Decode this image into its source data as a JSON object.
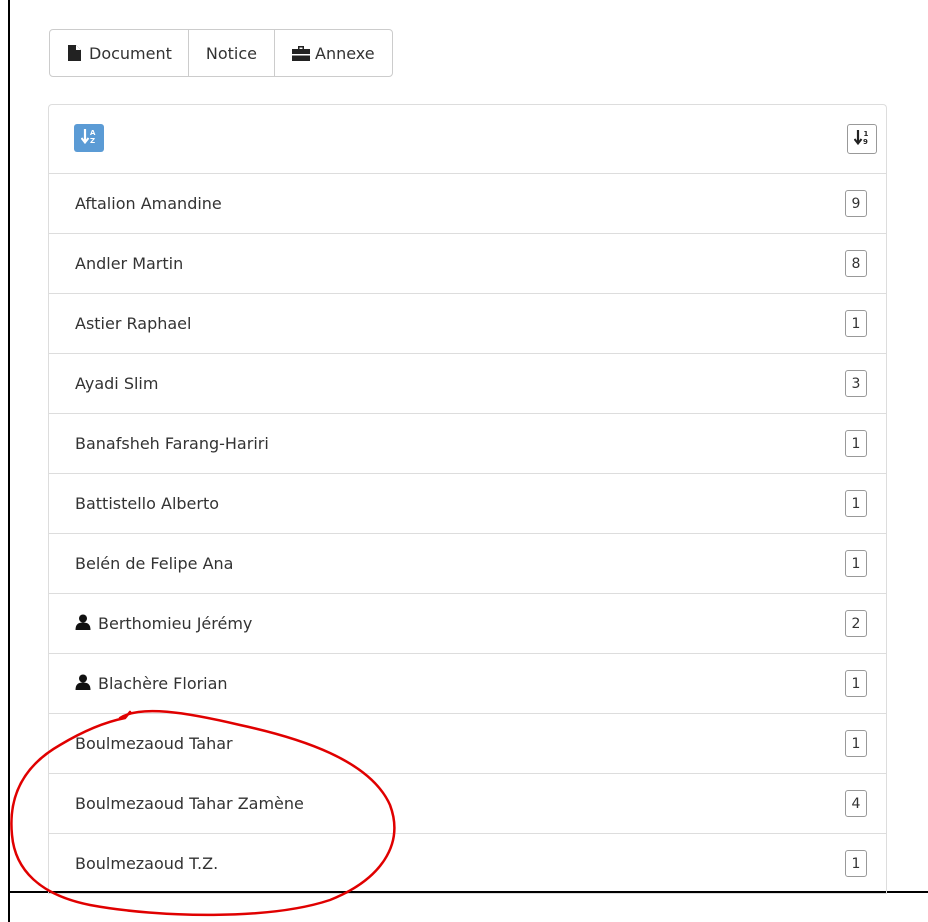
{
  "toolbar": {
    "buttons": [
      {
        "label": "Document",
        "icon": "file-icon"
      },
      {
        "label": "Notice"
      },
      {
        "label": "Annexe",
        "icon": "briefcase-icon"
      }
    ]
  },
  "panel": {
    "sort_alpha_icon": "sort-alpha-icon",
    "sort_count_icon": "sort-numeric-icon",
    "colors": {
      "active_sort": "#5b9bd5",
      "annotation": "#e00000"
    },
    "rows": [
      {
        "name": "Aftalion Amandine",
        "count": "9",
        "user_icon": false
      },
      {
        "name": "Andler Martin",
        "count": "8",
        "user_icon": false
      },
      {
        "name": "Astier Raphael",
        "count": "1",
        "user_icon": false
      },
      {
        "name": "Ayadi Slim",
        "count": "3",
        "user_icon": false
      },
      {
        "name": "Banafsheh Farang-Hariri",
        "count": "1",
        "user_icon": false
      },
      {
        "name": "Battistello Alberto",
        "count": "1",
        "user_icon": false
      },
      {
        "name": "Belén de Felipe Ana",
        "count": "1",
        "user_icon": false
      },
      {
        "name": "Berthomieu Jérémy",
        "count": "2",
        "user_icon": true
      },
      {
        "name": "Blachère Florian",
        "count": "1",
        "user_icon": true
      },
      {
        "name": "Boulmezaoud Tahar",
        "count": "1",
        "user_icon": false
      },
      {
        "name": "Boulmezaoud Tahar Zamène",
        "count": "4",
        "user_icon": false
      },
      {
        "name": "Boulmezaoud T.Z.",
        "count": "1",
        "user_icon": false
      }
    ]
  }
}
